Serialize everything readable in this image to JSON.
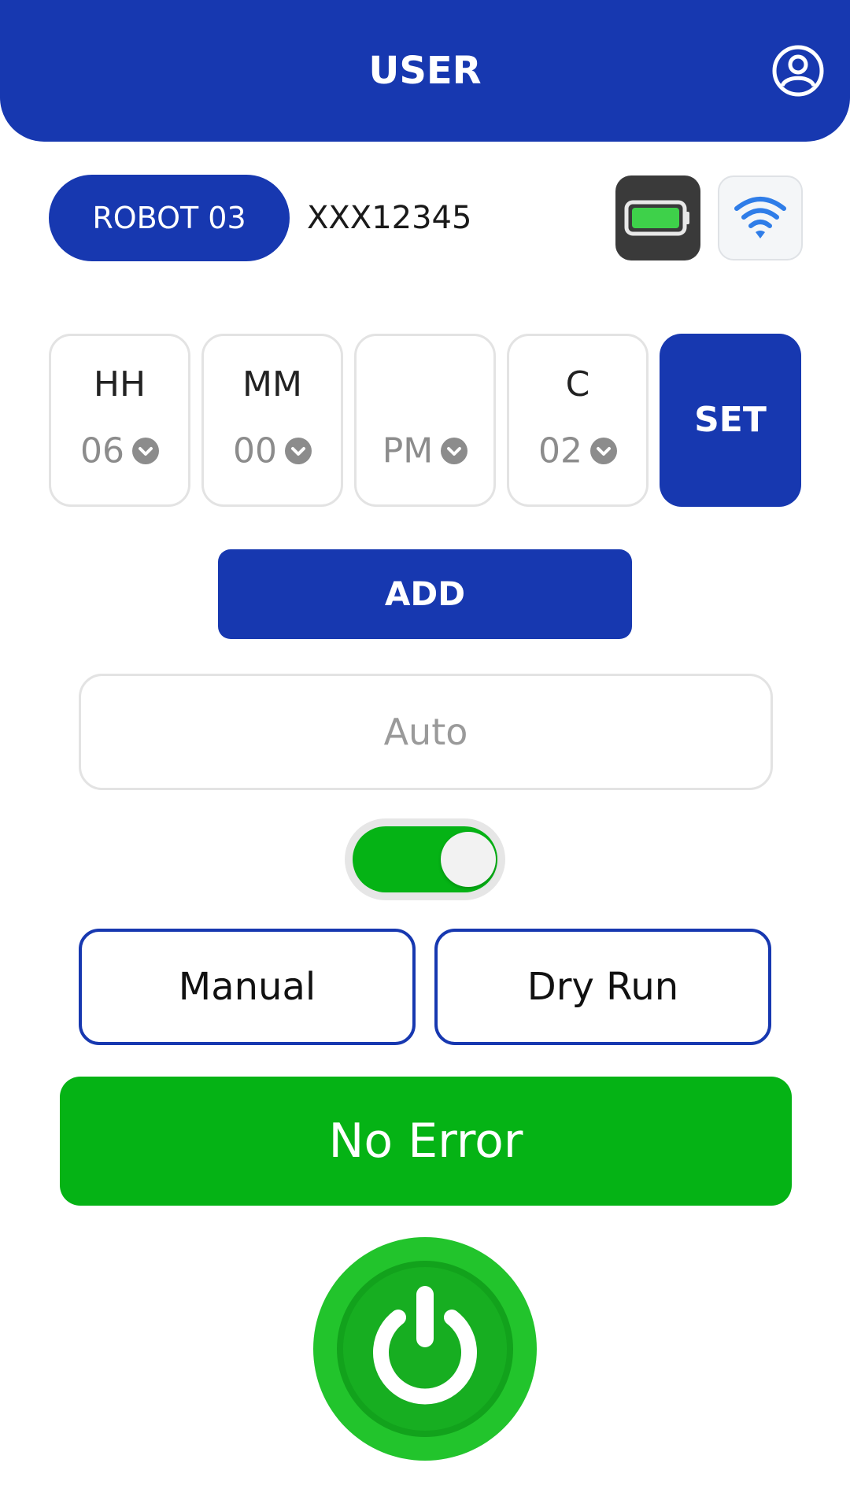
{
  "header": {
    "title": "USER",
    "profile_icon": "user-circle-icon"
  },
  "robot": {
    "name": "ROBOT 03",
    "serial": "XXX12345",
    "battery_icon": "battery-full-icon",
    "wifi_icon": "wifi-icon",
    "battery_level": 1.0
  },
  "schedule": {
    "hour": {
      "label": "HH",
      "value": "06"
    },
    "minute": {
      "label": "MM",
      "value": "00"
    },
    "period": {
      "label": "",
      "value": "PM"
    },
    "cycle": {
      "label": "C",
      "value": "02"
    },
    "set_label": "SET"
  },
  "add_label": "ADD",
  "mode_field": {
    "value": "Auto"
  },
  "toggle": {
    "on": true
  },
  "buttons": {
    "manual": "Manual",
    "dry_run": "Dry Run"
  },
  "status": {
    "text": "No Error"
  },
  "colors": {
    "primary": "#1738b0",
    "success": "#05b315",
    "border": "#e3e3e3"
  },
  "power_icon": "power-icon"
}
